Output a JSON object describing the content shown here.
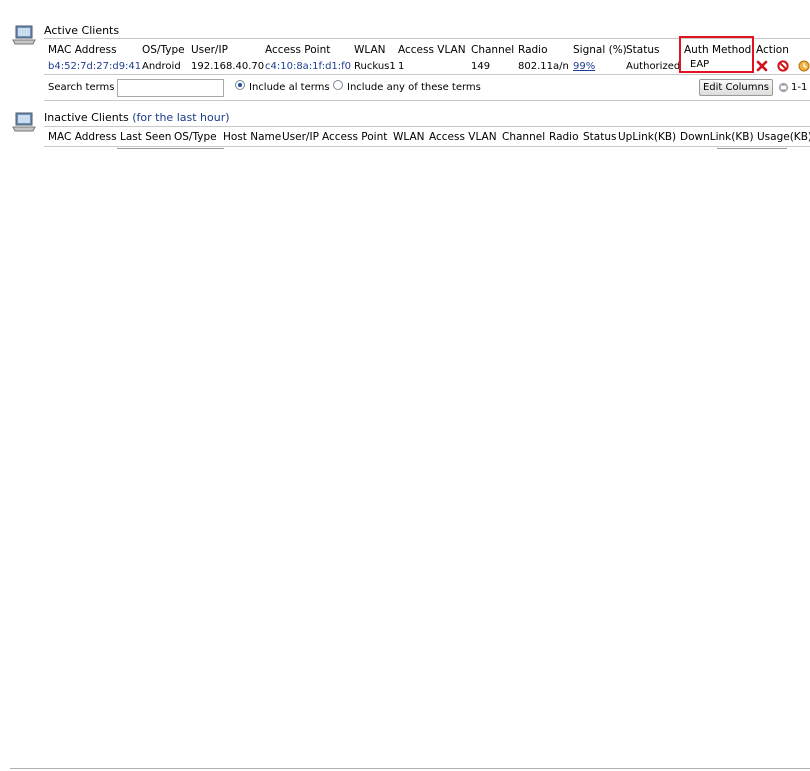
{
  "active": {
    "title": "Active Clients",
    "columns": [
      "MAC Address",
      "OS/Type",
      "User/IP",
      "Access Point",
      "WLAN",
      "Access VLAN",
      "Channel",
      "Radio",
      "Signal (%)",
      "Status",
      "Auth Method",
      "Action"
    ],
    "row": {
      "mac": "b4:52:7d:27:d9:41",
      "os": "Android",
      "ip": "192.168.40.70",
      "ap": "c4:10:8a:1f:d1:f0",
      "wlan": "Ruckus1",
      "vlan": "1",
      "channel": "149",
      "radio": "802.11a/n",
      "signal": "99%",
      "status": "Authorized",
      "auth": "EAP"
    },
    "search_label": "Search terms",
    "search_value": "",
    "radio_all": "Include al terms",
    "radio_any": "Include any of these terms",
    "edit_columns": "Edit Columns",
    "pager": "1-1",
    "action_icons": [
      "delete-icon",
      "block-icon",
      "refresh-icon"
    ]
  },
  "inactive": {
    "title": "Inactive Clients",
    "subtitle": "(for the last hour)",
    "columns": [
      "MAC Address",
      "Last Seen",
      "OS/Type",
      "Host Name",
      "User/IP",
      "Access Point",
      "WLAN",
      "Access VLAN",
      "Channel",
      "Radio",
      "Status",
      "UpLink(KB)",
      "DownLink(KB)",
      "Usage(KB)"
    ]
  },
  "colors": {
    "link": "#1f3f8f",
    "highlight": "#e0141e"
  }
}
